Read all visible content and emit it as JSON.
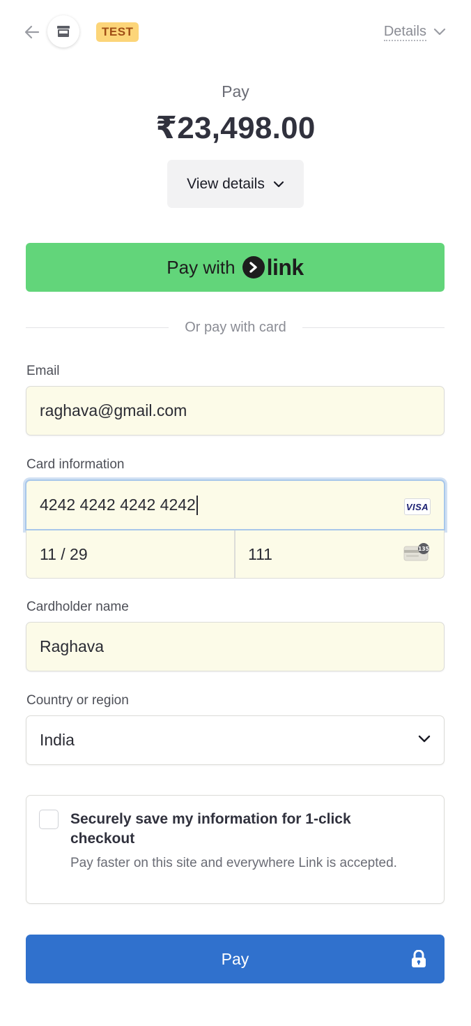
{
  "header": {
    "badge": "TEST",
    "details_label": "Details"
  },
  "summary": {
    "pay_label": "Pay",
    "amount": "₹23,498.00",
    "view_details_label": "View details"
  },
  "link_button": {
    "prefix": "Pay with",
    "brand": "link"
  },
  "divider": {
    "text": "Or pay with card"
  },
  "email": {
    "label": "Email",
    "value": "raghava@gmail.com"
  },
  "card": {
    "label": "Card information",
    "number": "4242 4242 4242 4242",
    "brand": "VISA",
    "expiry": "11 / 29",
    "cvc": "111",
    "cvc_icon_text": "135"
  },
  "cardholder": {
    "label": "Cardholder name",
    "value": "Raghava"
  },
  "country": {
    "label": "Country or region",
    "value": "India"
  },
  "save_info": {
    "title": "Securely save my information for 1-click checkout",
    "description": "Pay faster on this site and everywhere Link is accepted."
  },
  "pay_button": {
    "label": "Pay"
  },
  "colors": {
    "link_green": "#62d57a",
    "pay_blue": "#3071cd",
    "test_badge_bg": "#fcd579",
    "autofill_bg": "#fcfbe8"
  }
}
